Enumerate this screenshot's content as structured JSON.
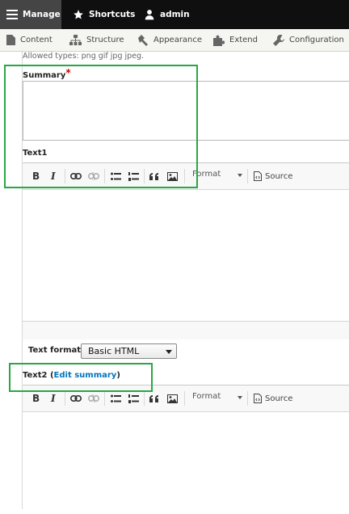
{
  "toolbar": {
    "manage": "Manage",
    "shortcuts": "Shortcuts",
    "user": "admin"
  },
  "menu": {
    "items": [
      {
        "label": "Content",
        "icon": "page-icon"
      },
      {
        "label": "Structure",
        "icon": "hierarchy-icon"
      },
      {
        "label": "Appearance",
        "icon": "paintbrush-icon"
      },
      {
        "label": "Extend",
        "icon": "puzzle-icon"
      },
      {
        "label": "Configuration",
        "icon": "wrench-icon"
      }
    ]
  },
  "form": {
    "allowed_types": "Allowed types: png gif jpg jpeg.",
    "summary_label": "Summary",
    "required_mark": "*",
    "text1_label": "Text1",
    "text2_label": "Text2",
    "text2_open_paren": " (",
    "edit_summary_link": "Edit summary",
    "text2_close_paren": ")",
    "text_format_label": "Text format",
    "text_format_value": "Basic HTML"
  },
  "editor_toolbar": {
    "bold": "B",
    "italic": "I",
    "format_label": "Format",
    "source_label": "Source"
  },
  "colors": {
    "highlight": "#28a745",
    "link": "#0074bd",
    "required": "#cc0000",
    "toolbar_bg": "#0f0f0f"
  }
}
